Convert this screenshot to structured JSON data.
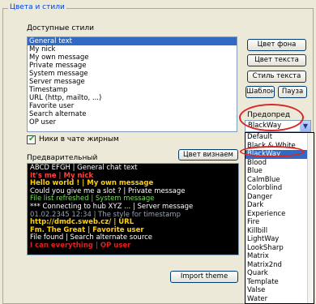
{
  "group": {
    "title": "Цвета и стили"
  },
  "styles": {
    "label": "Доступные стили",
    "items": [
      "General text",
      "My nick",
      "My own message",
      "Private message",
      "System message",
      "Server message",
      "Timestamp",
      "URL (http, mailto, ...)",
      "Favorite user",
      "Search alternate",
      "OP user"
    ],
    "selected_index": 0
  },
  "buttons": {
    "bg_color": "Цвет фона",
    "text_color": "Цвет текста",
    "text_style": "Стиль текста",
    "default": "Шаблон",
    "pause": "Пауза",
    "theme_color": "Цвет визнаем",
    "import_theme": "Import theme"
  },
  "bold_nicks": {
    "label": "Ники в чате жирным",
    "checked": true
  },
  "preview": {
    "label": "Предварительный",
    "lines": [
      {
        "text": "ABCD EFGH | General chat text",
        "color": "#ffffff",
        "bold": false
      },
      {
        "text": "It's me | My nick",
        "color": "#ff4040",
        "bold": true
      },
      {
        "text": "Hello world ! | My own message",
        "color": "#ffd200",
        "bold": true
      },
      {
        "text": "Could you give me a slot ? | Private message",
        "color": "#ffffff",
        "bold": false
      },
      {
        "text": "File list refreshed | System message",
        "color": "#7ad85a",
        "bold": false
      },
      {
        "text": "*** Connecting to hub XYZ ... | Server message",
        "color": "#ffffff",
        "bold": false
      },
      {
        "text": "01.02.2345 12:34 | The style for timestamp",
        "color": "#9aa0b2",
        "bold": false
      },
      {
        "text": "http://dmdc.sweb.cz/ | URL",
        "color": "#ffd200",
        "bold": true
      },
      {
        "text": "Fm. The Great | Favorite user",
        "color": "#ffd200",
        "bold": true
      },
      {
        "text": "File found | Search alternate source",
        "color": "#ffffff",
        "bold": false
      },
      {
        "text": "I can everything | OP user",
        "color": "#e02020",
        "bold": true
      }
    ]
  },
  "preset": {
    "label": "Предопред",
    "value": "BlackWay",
    "options": [
      "Default",
      "Black & White",
      "BlackWay",
      "Blood",
      "Blue",
      "CalmBlue",
      "Colorblind",
      "Danger",
      "Dark",
      "Experience",
      "Fire",
      "Killbill",
      "LightWay",
      "LookSharp",
      "Matrix",
      "Matrix2nd",
      "Quark",
      "Template",
      "Valse",
      "Water"
    ],
    "highlighted_index": 2
  },
  "colors": {
    "selection": "#316ac5",
    "annotation": "#d92626",
    "preview_bg": "#000000"
  },
  "icons": {
    "check": "checkmark-icon",
    "arrow": "chevron-down-icon"
  }
}
